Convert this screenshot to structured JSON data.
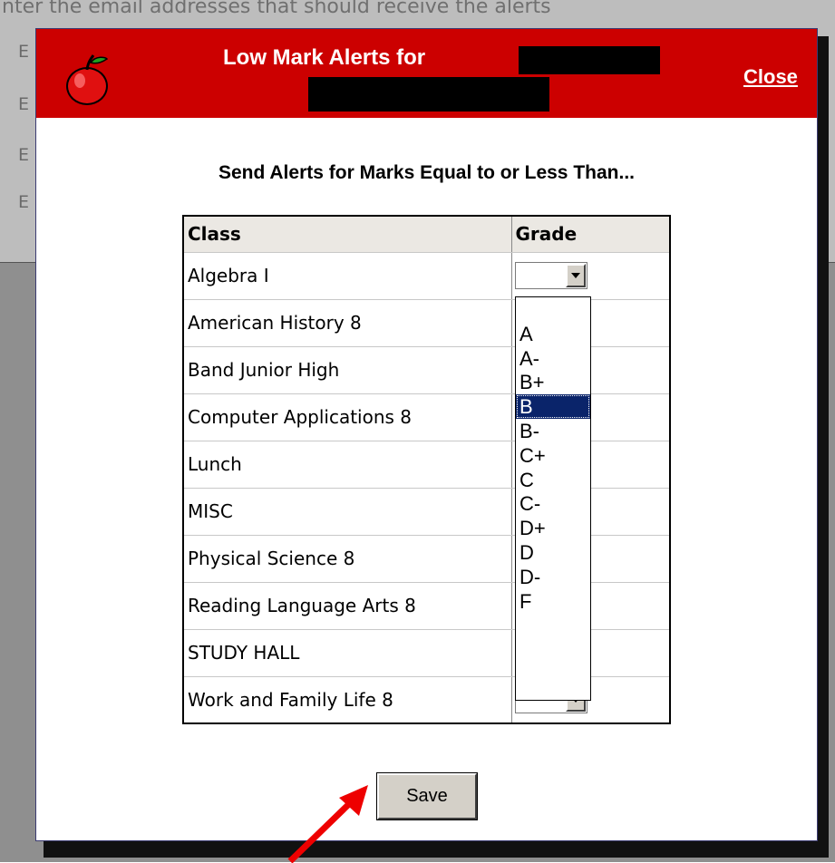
{
  "background": {
    "top_text": "nter the email addresses that should receive the alerts",
    "side_letters": [
      "E",
      "E",
      "E",
      "E"
    ]
  },
  "modal": {
    "title": "Low Mark Alerts for",
    "close_label": "Close",
    "instruction": "Send Alerts for Marks Equal to or Less Than...",
    "accent_color": "#cc0000"
  },
  "table": {
    "headers": {
      "class": "Class",
      "grade": "Grade"
    },
    "rows": [
      {
        "class": "Algebra I",
        "grade": ""
      },
      {
        "class": "American History 8",
        "grade": ""
      },
      {
        "class": "Band Junior High",
        "grade": ""
      },
      {
        "class": "Computer Applications 8",
        "grade": ""
      },
      {
        "class": "Lunch",
        "grade": ""
      },
      {
        "class": "MISC",
        "grade": ""
      },
      {
        "class": "Physical Science 8",
        "grade": ""
      },
      {
        "class": "Reading Language Arts 8",
        "grade": ""
      },
      {
        "class": "STUDY HALL",
        "grade": ""
      },
      {
        "class": "Work and Family Life 8",
        "grade": ""
      }
    ]
  },
  "dropdown": {
    "options": [
      "",
      "A",
      "A-",
      "B+",
      "B",
      "B-",
      "C+",
      "C",
      "C-",
      "D+",
      "D",
      "D-",
      "F"
    ],
    "highlighted": "B"
  },
  "save_label": "Save"
}
